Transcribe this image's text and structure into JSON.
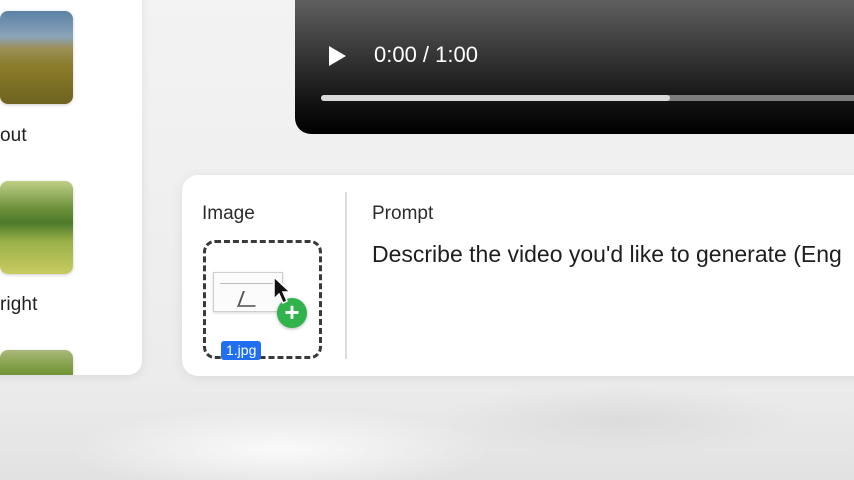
{
  "gallery": {
    "items": [
      {
        "label": "out"
      },
      {
        "label": "right"
      }
    ]
  },
  "player": {
    "time": "0:00 / 1:00",
    "progress": 0.64,
    "play_icon": "play-icon"
  },
  "prompt_panel": {
    "image_label": "Image",
    "file_chip": "1.jpg",
    "add_icon": "+",
    "prompt_label": "Prompt",
    "prompt_placeholder": "Describe the video you'd like to generate (Eng"
  },
  "colors": {
    "accent_blue": "#1f6ff0",
    "add_green": "#2fb34a"
  }
}
